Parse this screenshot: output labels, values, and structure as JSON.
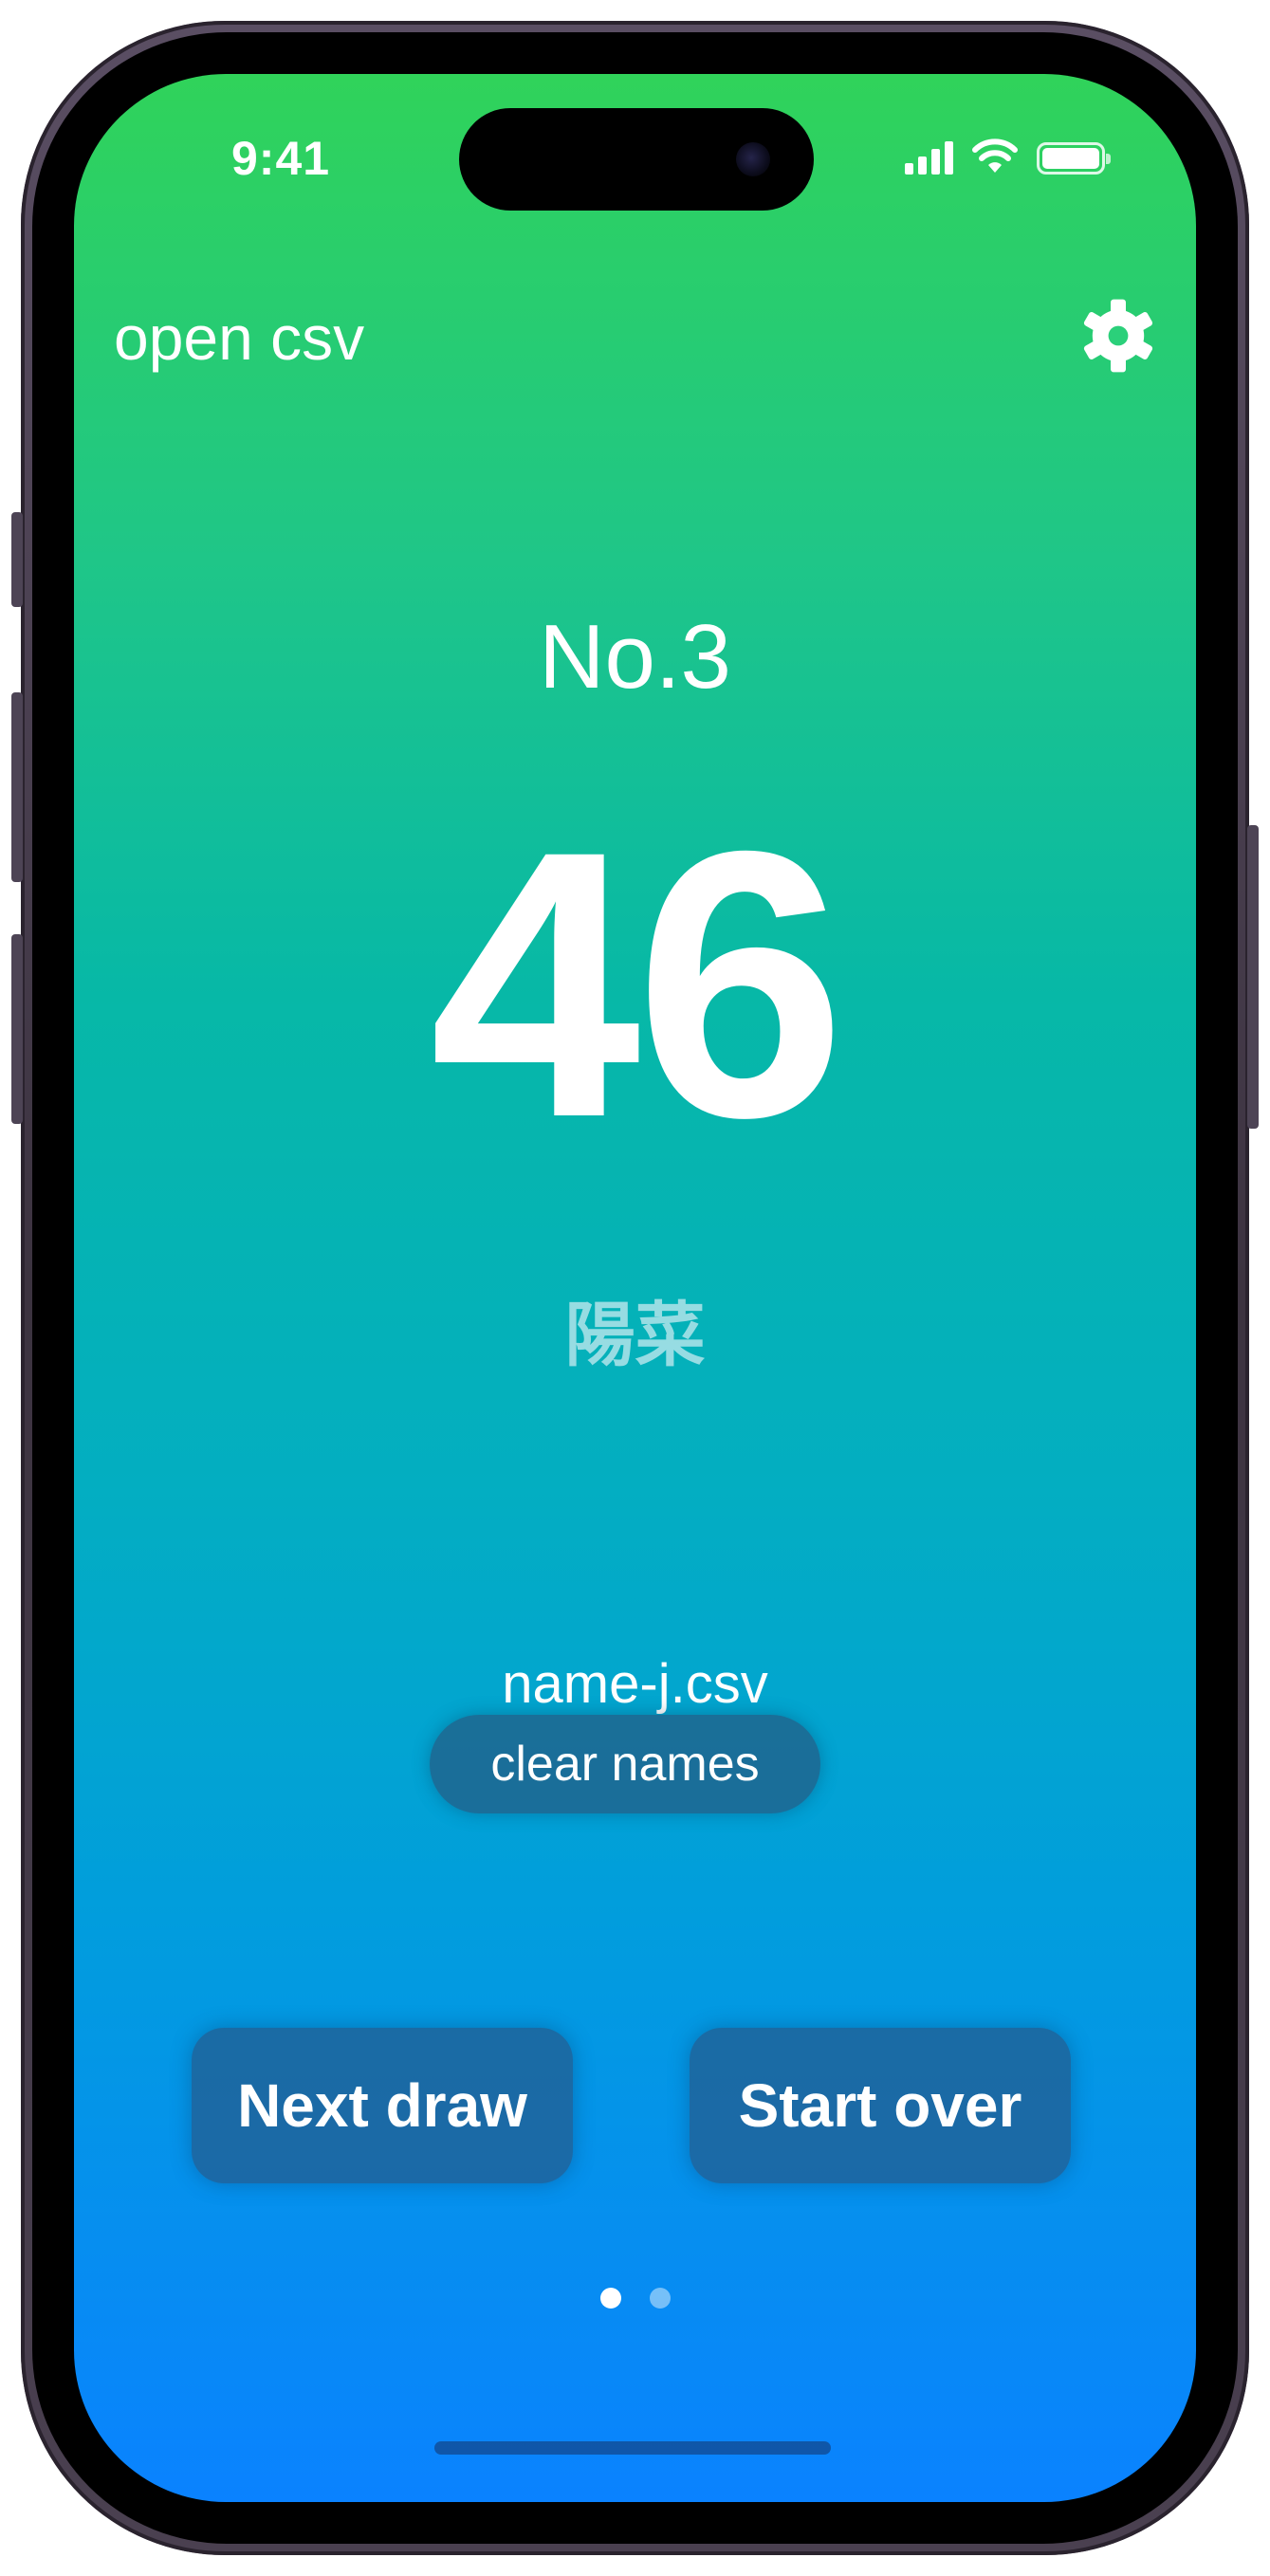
{
  "status_bar": {
    "time": "9:41",
    "icons": [
      "cellular-signal-icon",
      "wifi-icon",
      "battery-icon"
    ]
  },
  "header": {
    "open_csv_label": "open csv",
    "settings_icon": "gear-icon"
  },
  "draw": {
    "count_label": "No.3",
    "number": "46",
    "name": "陽菜"
  },
  "csv": {
    "file_name": "name-j.csv",
    "clear_label": "clear names"
  },
  "actions": {
    "next_label": "Next draw",
    "start_over_label": "Start over"
  },
  "pager": {
    "pages": 2,
    "current": 1
  },
  "colors": {
    "gradient_top": "#30d35a",
    "gradient_bottom": "#0a82ff",
    "button_fill": "#245a8c"
  }
}
